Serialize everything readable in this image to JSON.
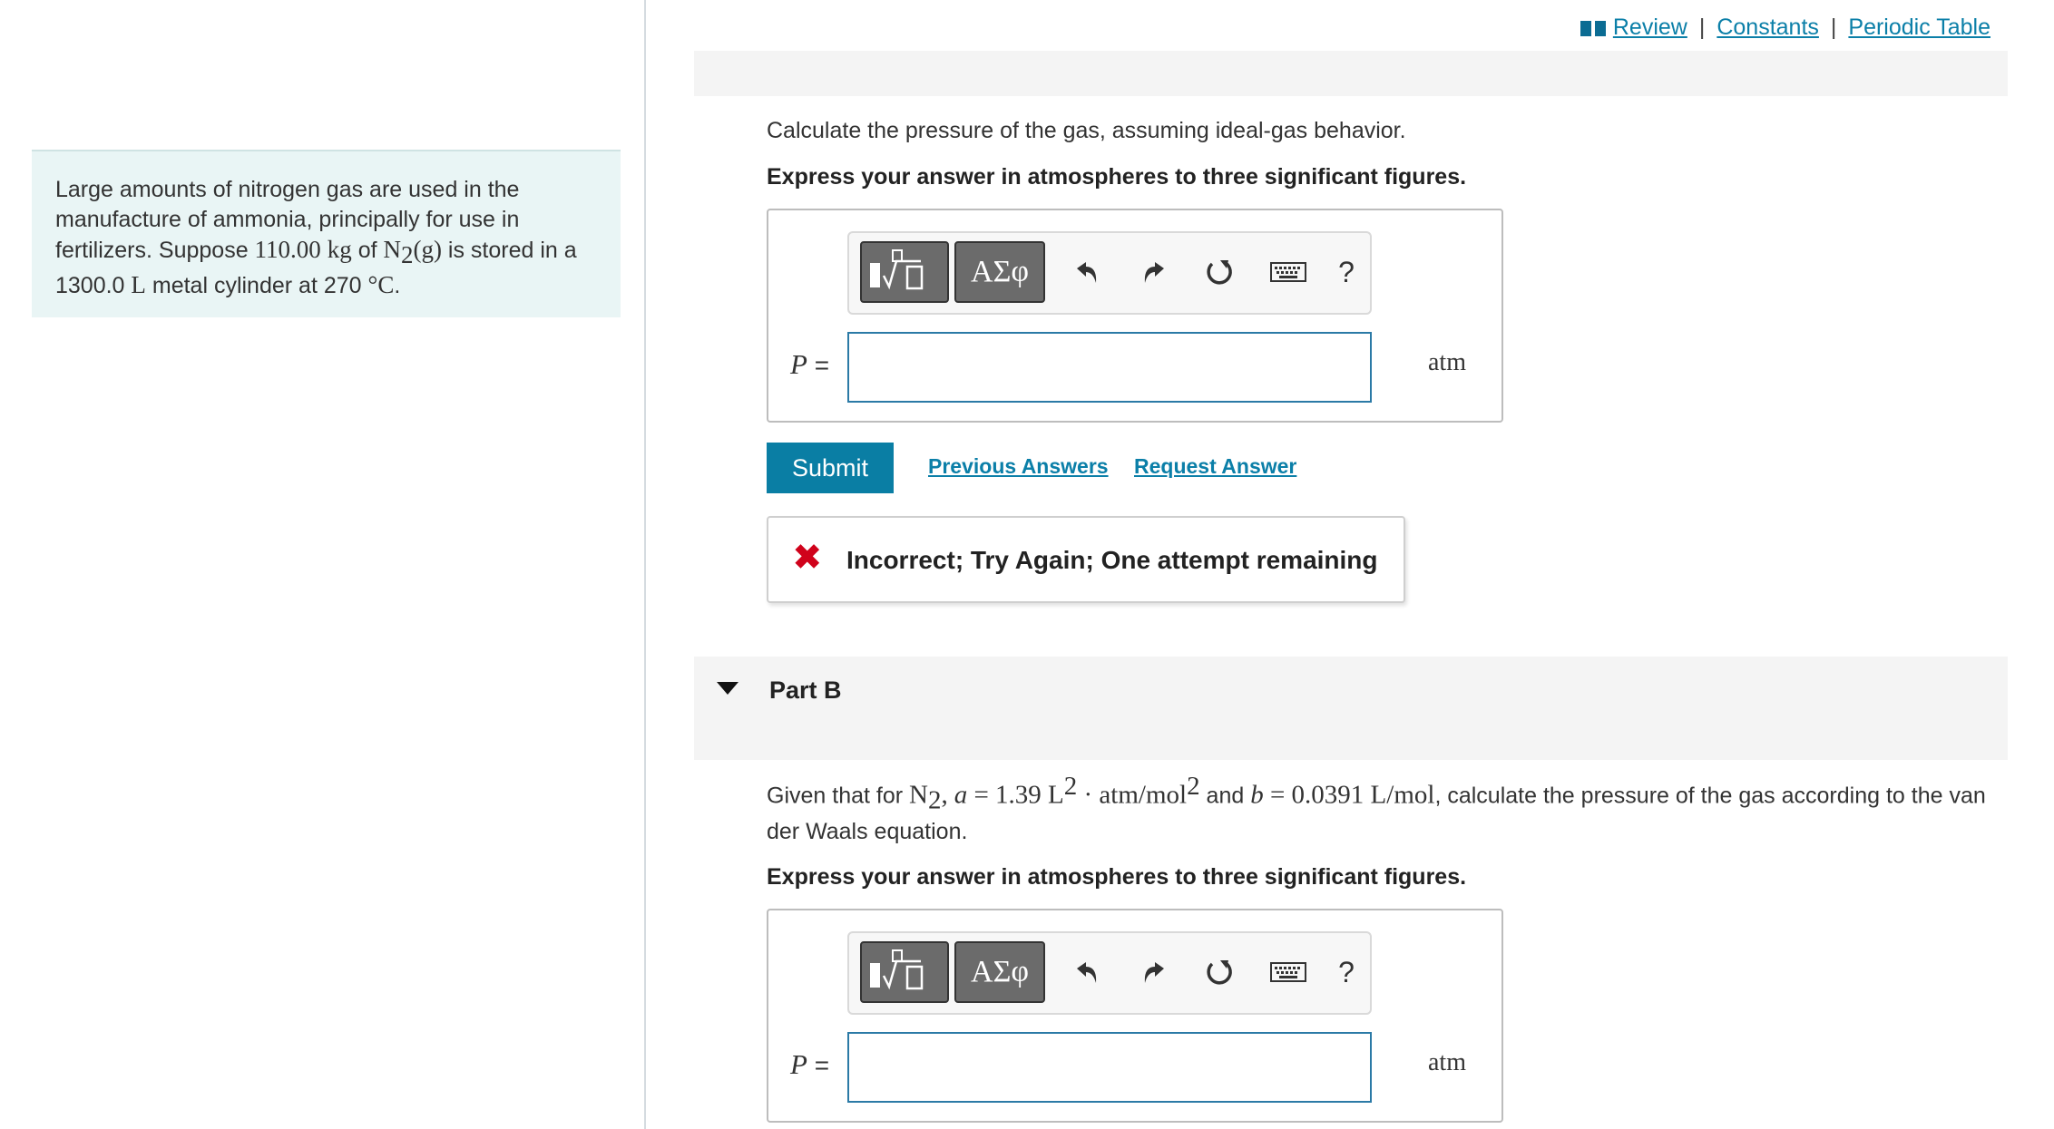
{
  "top_links": {
    "review": "Review",
    "constants": "Constants",
    "periodic_table": "Periodic Table",
    "separator": "|"
  },
  "context": {
    "t1": "Large amounts of nitrogen gas are used in the manufacture of ammonia, principally for use in fertilizers. Suppose ",
    "mass": "110.00",
    "mass_unit": "kg",
    "t2": " of ",
    "species": "N",
    "species_sub": "2",
    "species_state": "(g)",
    "t3": " is stored in a ",
    "volume": "1300.0",
    "volume_unit": "L",
    "t4": " metal cylinder at ",
    "temp": "270",
    "temp_unit": "°C",
    "t5": "."
  },
  "part_a": {
    "question": "Calculate the pressure of the gas, assuming ideal-gas behavior.",
    "instruction": "Express your answer in atmospheres to three significant figures.",
    "var_label": "P",
    "equals": "=",
    "unit": "atm",
    "input_value": "",
    "toolbar": {
      "greek": "ΑΣφ",
      "help": "?"
    },
    "submit": "Submit",
    "previous_answers": "Previous Answers",
    "request_answer": "Request Answer",
    "feedback": "Incorrect; Try Again; One attempt remaining"
  },
  "part_b": {
    "title": "Part B",
    "g1": "Given that for ",
    "species": "N",
    "species_sub": "2",
    "comma": ",",
    "a_var": "a",
    "a_value": " = 1.39 L",
    "a_sup": "2",
    "a_units": " · atm/mol",
    "a_units_sup": "2",
    "g2": " and ",
    "b_var": "b",
    "b_value": " = 0.0391 L/mol",
    "g3": ", calculate the pressure of the gas according to the van der Waals equation.",
    "instruction": "Express your answer in atmospheres to three significant figures.",
    "var_label": "P",
    "equals": "=",
    "unit": "atm",
    "input_value": "",
    "toolbar": {
      "greek": "ΑΣφ",
      "help": "?"
    }
  }
}
